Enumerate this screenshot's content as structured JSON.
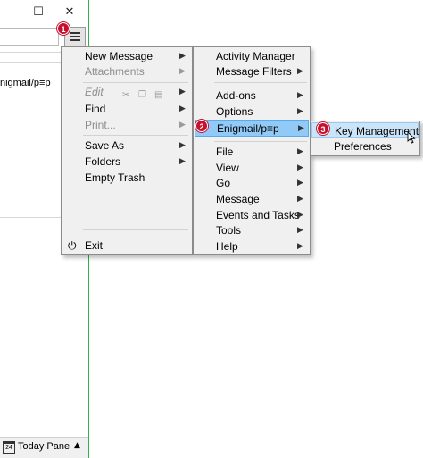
{
  "window": {
    "minimize_icon": "minimize-icon",
    "maximize_icon": "maximize-icon",
    "close_icon": "close-icon",
    "folder_text": "nigmail/p≡p",
    "status_bar": {
      "today_pane": "Today Pane",
      "calendar_icon_text": "24"
    }
  },
  "badges": [
    "1",
    "2",
    "3"
  ],
  "menu1": {
    "items": [
      {
        "label": "New Message",
        "submenu": true,
        "disabled": false
      },
      {
        "label": "Attachments",
        "submenu": true,
        "disabled": true
      },
      {
        "label": "Edit",
        "submenu": true,
        "disabled": true
      },
      {
        "label": "Find",
        "submenu": true,
        "disabled": false
      },
      {
        "label": "Print...",
        "submenu": true,
        "disabled": true
      },
      {
        "label": "Save As",
        "submenu": true,
        "disabled": false
      },
      {
        "label": "Folders",
        "submenu": true,
        "disabled": false
      },
      {
        "label": "Empty Trash",
        "submenu": false,
        "disabled": false
      },
      {
        "label": "Exit",
        "submenu": false,
        "disabled": false
      }
    ]
  },
  "menu2": {
    "items": [
      {
        "label": "Activity Manager",
        "submenu": false
      },
      {
        "label": "Message Filters",
        "submenu": true
      },
      {
        "label": "Add-ons",
        "submenu": true
      },
      {
        "label": "Options",
        "submenu": true
      },
      {
        "label": "Enigmail/p≡p",
        "submenu": true,
        "highlighted": true
      },
      {
        "label": "File",
        "submenu": true
      },
      {
        "label": "View",
        "submenu": true
      },
      {
        "label": "Go",
        "submenu": true
      },
      {
        "label": "Message",
        "submenu": true
      },
      {
        "label": "Events and Tasks",
        "submenu": true
      },
      {
        "label": "Tools",
        "submenu": true
      },
      {
        "label": "Help",
        "submenu": true
      }
    ]
  },
  "menu3": {
    "items": [
      {
        "label": "Key Management",
        "selected": true
      },
      {
        "label": "Preferences",
        "selected": false
      }
    ]
  },
  "colors": {
    "highlight": "#91c9f7",
    "badge": "#c8102e",
    "window_border": "#2bb24c"
  }
}
